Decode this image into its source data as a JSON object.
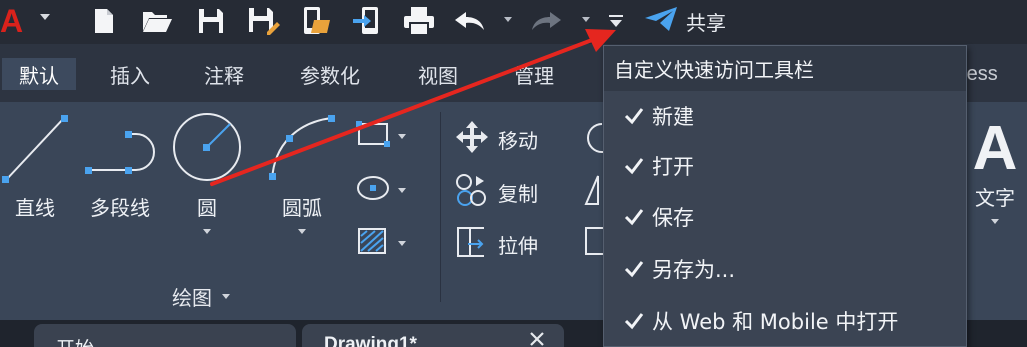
{
  "quick_access": {
    "logo_text": "A",
    "share_label": "共享",
    "icons": [
      "new-icon",
      "open-icon",
      "save-icon",
      "save-as-icon",
      "open-web-mobile-icon",
      "save-to-web-mobile-icon",
      "print-icon",
      "undo-icon",
      "redo-icon",
      "customize-dropdown-icon",
      "share-icon"
    ]
  },
  "ribbon_tabs": [
    "默认",
    "插入",
    "注释",
    "参数化",
    "视图",
    "管理",
    "ress"
  ],
  "draw_panel": {
    "tools": [
      {
        "label": "直线",
        "icon": "line-icon"
      },
      {
        "label": "多段线",
        "icon": "polyline-icon"
      },
      {
        "label": "圆",
        "icon": "circle-icon"
      },
      {
        "label": "圆弧",
        "icon": "arc-icon"
      }
    ],
    "small_tools": [
      "rectangle-icon",
      "ellipse-icon",
      "hatch-icon"
    ],
    "panel_title": "绘图"
  },
  "modify_panel": {
    "tools": [
      {
        "label": "移动",
        "icon": "move-icon"
      },
      {
        "label": "复制",
        "icon": "copy-icon"
      },
      {
        "label": "拉伸",
        "icon": "stretch-icon"
      }
    ]
  },
  "text_panel": {
    "label": "文字",
    "icon_glyph": "A"
  },
  "menu": {
    "title": "自定义快速访问工具栏",
    "items": [
      {
        "label": "新建",
        "checked": true
      },
      {
        "label": "打开",
        "checked": true
      },
      {
        "label": "保存",
        "checked": true
      },
      {
        "label": "另存为...",
        "checked": true
      },
      {
        "label": "从 Web 和 Mobile 中打开",
        "checked": true
      }
    ]
  },
  "doc_tabs": [
    "开始",
    "Drawing1*"
  ],
  "colors": {
    "accent_red": "#e5261f",
    "share_blue": "#4aa3ef",
    "ribbon_bg": "#3a4658",
    "toolbar_bg": "#262b35"
  }
}
